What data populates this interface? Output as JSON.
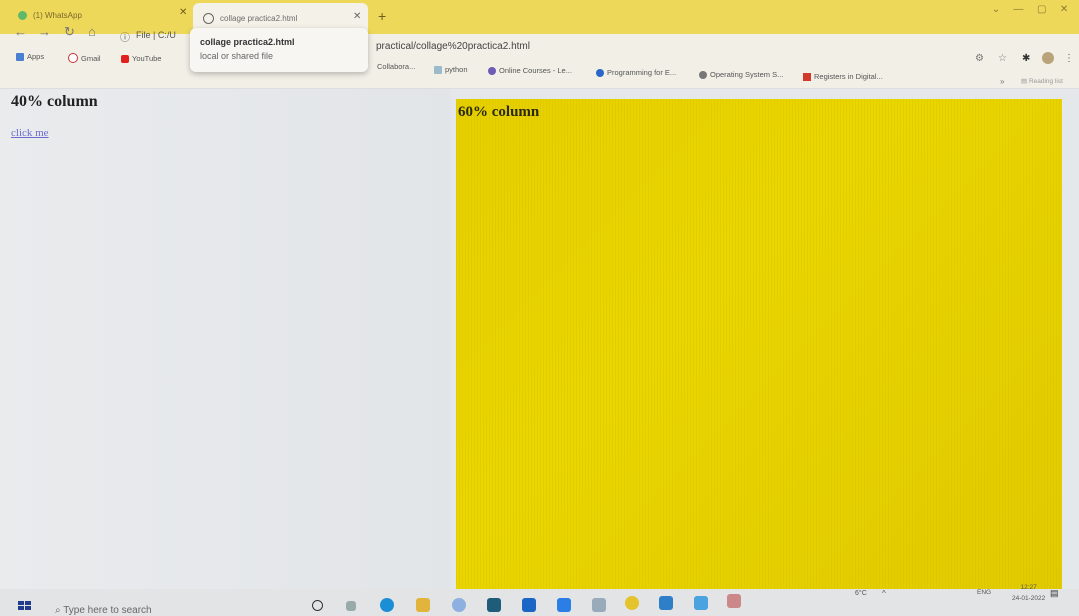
{
  "tabs": [
    {
      "title": "(1) WhatsApp"
    },
    {
      "title": "collage practica2.html"
    }
  ],
  "hovercard": {
    "title": "collage practica2.html",
    "subtitle": "local or shared file"
  },
  "address": {
    "prefix": "File",
    "path_start": "C:/U",
    "path_end": "practical/collage%20practica2.html"
  },
  "bookmarks": [
    {
      "label": "Apps"
    },
    {
      "label": "Gmail"
    },
    {
      "label": "YouTube"
    },
    {
      "label": "Collabora..."
    },
    {
      "label": "python"
    },
    {
      "label": "Online Courses - Le..."
    },
    {
      "label": "Programming for E..."
    },
    {
      "label": "Operating System S..."
    },
    {
      "label": "Registers in Digital..."
    }
  ],
  "reading_list": "Reading list",
  "page": {
    "left_heading": "40% column",
    "link_text": "click me",
    "right_heading": "60% column"
  },
  "taskbar": {
    "search_placeholder": "Type here to search",
    "weather": "6°C",
    "lang": "ENG",
    "time": "12:27",
    "date": "24-01-2022"
  },
  "colors": {
    "accent_yellow": "#e7d100",
    "tab_strip": "#eed85a"
  }
}
